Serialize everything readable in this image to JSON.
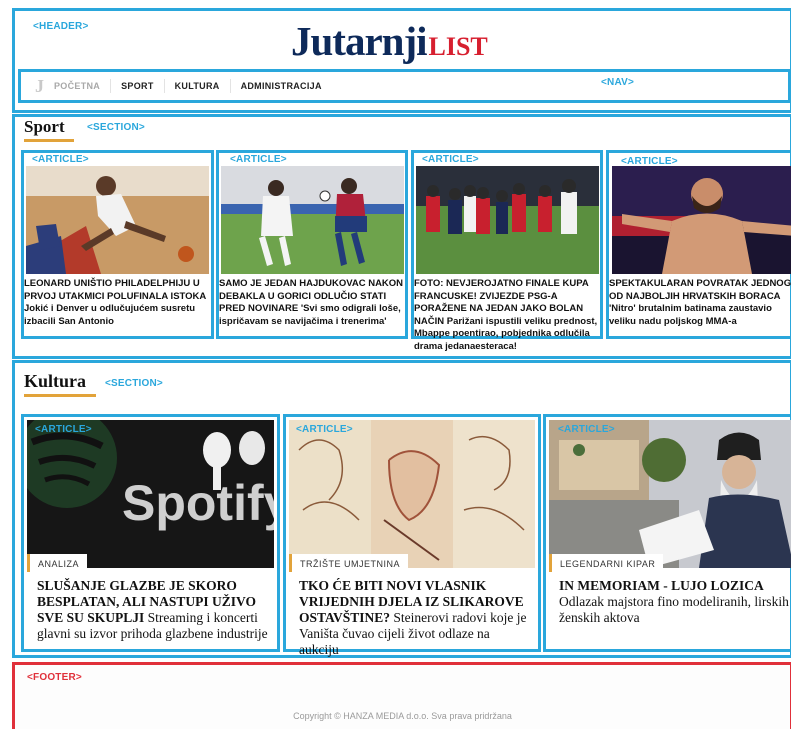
{
  "labels": {
    "header": "<HEADER>",
    "nav": "<NAV>",
    "section": "<SECTION>",
    "article": "<ARTICLE>",
    "footer": "<FOOTER>"
  },
  "logo": {
    "main": "Jutarnji",
    "accent": "LIST"
  },
  "nav": {
    "items": [
      "POČETNA",
      "SPORT",
      "KULTURA",
      "ADMINISTRACIJA"
    ]
  },
  "sport": {
    "title": "Sport",
    "articles": [
      {
        "headline": "LEONARD UNIŠTIO PHILADELPHIJU U PRVOJ UTAKMICI POLUFINALA ISTOKA",
        "sub": "Jokić i Denver u odlučujućem susretu izbacili San Antonio"
      },
      {
        "headline": "SAMO JE JEDAN HAJDUKOVAC NAKON DEBAKLA U GORICI ODLUČIO STATI PRED NOVINARE",
        "sub": "'Svi smo odigrali loše, ispričavam se navijačima i trenerima'"
      },
      {
        "headline": "FOTO: NEVJEROJATNO FINALE KUPA FRANCUSKE! ZVIJEZDE PSG-A PORAŽENE NA JEDAN JAKO BOLAN NAČIN",
        "sub": "Parižani ispustili veliku prednost, Mbappe poentirao, pobjednika odlučila drama jedanaesteraca!"
      },
      {
        "headline": "SPEKTAKULARAN POVRATAK JEDNOG OD NAJBOLJIH HRVATSKIH BORACA",
        "sub": "'Nitro' brutalnim batinama zaustavio veliku nadu poljskog MMA-a"
      }
    ]
  },
  "kultura": {
    "title": "Kultura",
    "articles": [
      {
        "badge": "ANALIZA",
        "headline": "SLUŠANJE GLAZBE JE SKORO BESPLATAN, ALI NASTUPI UŽIVO SVE SU SKUPLJI",
        "sub": "Streaming i koncerti glavni su izvor prihoda glazbene industrije",
        "image_word": "Spotify"
      },
      {
        "badge": "TRŽIŠTE UMJETNINA",
        "headline": "TKO ĆE BITI NOVI VLASNIK VRIJEDNIH DJELA IZ SLIKAROVE OSTAVŠTINE?",
        "sub": "Steinerovi radovi koje je Vaništa čuvao cijeli život odlaze na aukciju"
      },
      {
        "badge": "LEGENDARNI KIPAR",
        "headline": "IN MEMORIAM - LUJO LOZICA",
        "sub": "Odlazak majstora fino modeliranih, lirskih ženskih aktova"
      }
    ]
  },
  "footer": {
    "copyright": "Copyright © HANZA MEDIA d.o.o. Sva prava pridržana"
  },
  "colors": {
    "annotation_blue": "#2aa7dc",
    "annotation_red": "#e0303a",
    "logo_navy": "#0e2a5a",
    "logo_red": "#d71f2f",
    "section_accent": "#e2a33a"
  }
}
